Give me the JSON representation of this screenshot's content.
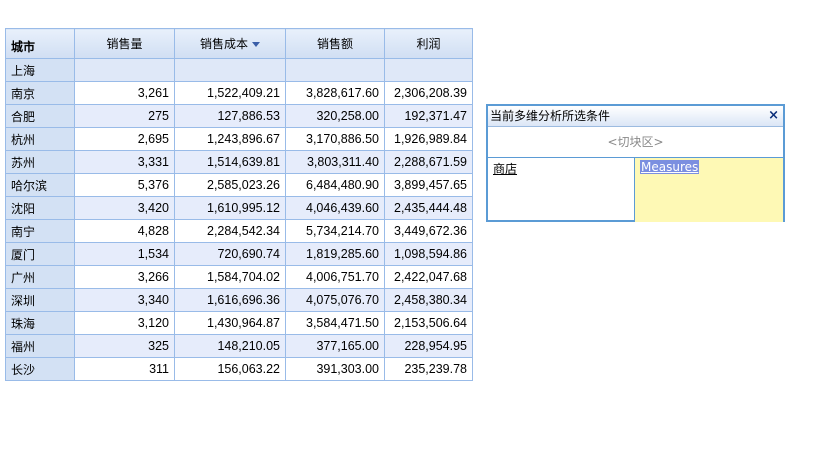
{
  "table": {
    "corner": "城市",
    "columns": [
      "销售量",
      "销售成本",
      "销售额",
      "利润"
    ],
    "sorted_column": "销售成本",
    "rows": [
      {
        "city": "上海",
        "values": [
          "",
          "",
          "",
          ""
        ]
      },
      {
        "city": "南京",
        "values": [
          "3,261",
          "1,522,409.21",
          "3,828,617.60",
          "2,306,208.39"
        ]
      },
      {
        "city": "合肥",
        "values": [
          "275",
          "127,886.53",
          "320,258.00",
          "192,371.47"
        ]
      },
      {
        "city": "杭州",
        "values": [
          "2,695",
          "1,243,896.67",
          "3,170,886.50",
          "1,926,989.84"
        ]
      },
      {
        "city": "苏州",
        "values": [
          "3,331",
          "1,514,639.81",
          "3,803,311.40",
          "2,288,671.59"
        ]
      },
      {
        "city": "哈尔滨",
        "values": [
          "5,376",
          "2,585,023.26",
          "6,484,480.90",
          "3,899,457.65"
        ]
      },
      {
        "city": "沈阳",
        "values": [
          "3,420",
          "1,610,995.12",
          "4,046,439.60",
          "2,435,444.48"
        ]
      },
      {
        "city": "南宁",
        "values": [
          "4,828",
          "2,284,542.34",
          "5,734,214.70",
          "3,449,672.36"
        ]
      },
      {
        "city": "厦门",
        "values": [
          "1,534",
          "720,690.74",
          "1,819,285.60",
          "1,098,594.86"
        ]
      },
      {
        "city": "广州",
        "values": [
          "3,266",
          "1,584,704.02",
          "4,006,751.70",
          "2,422,047.68"
        ]
      },
      {
        "city": "深圳",
        "values": [
          "3,340",
          "1,616,696.36",
          "4,075,076.70",
          "2,458,380.34"
        ]
      },
      {
        "city": "珠海",
        "values": [
          "3,120",
          "1,430,964.87",
          "3,584,471.50",
          "2,153,506.64"
        ]
      },
      {
        "city": "福州",
        "values": [
          "325",
          "148,210.05",
          "377,165.00",
          "228,954.95"
        ]
      },
      {
        "city": "长沙",
        "values": [
          "311",
          "156,063.22",
          "391,303.00",
          "235,239.78"
        ]
      }
    ]
  },
  "condition_panel": {
    "title": "当前多维分析所选条件",
    "close_icon": "×",
    "slice_zone": "<切块区>",
    "dimension": "商店",
    "measure": "Measures"
  }
}
